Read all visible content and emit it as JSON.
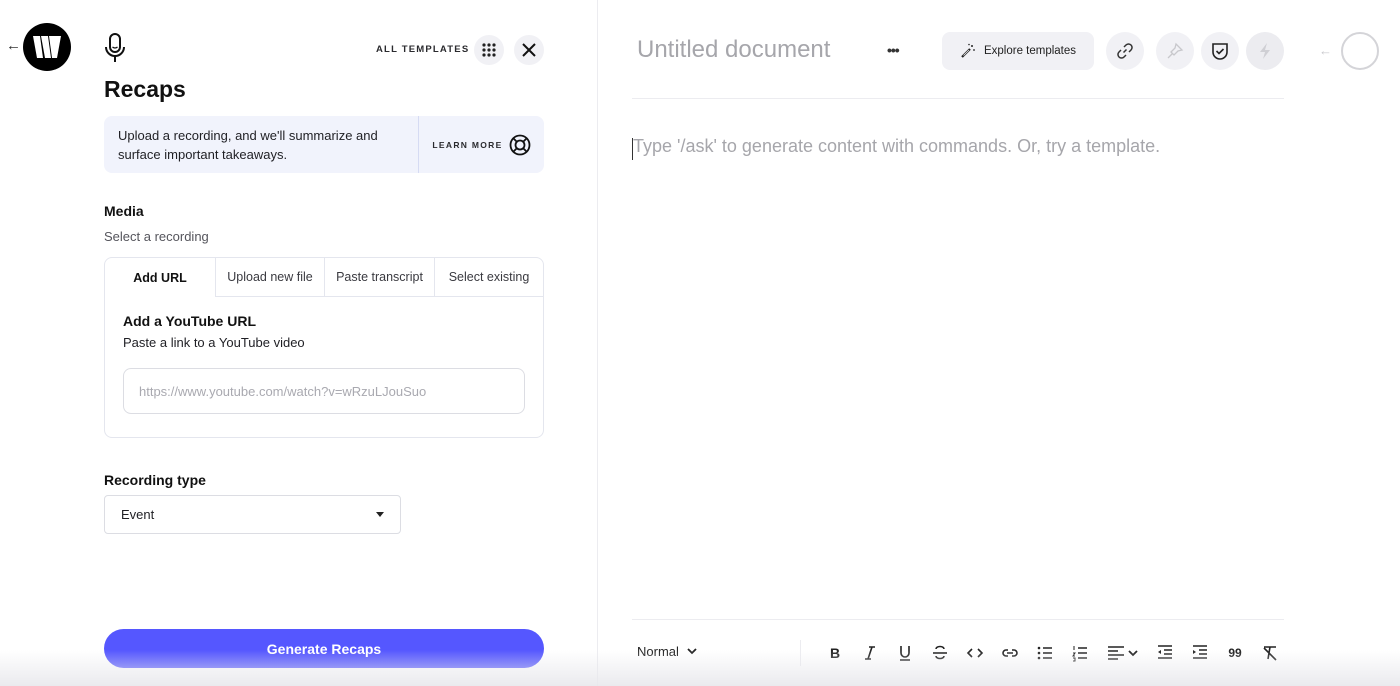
{
  "left_panel": {
    "all_templates_label": "ALL TEMPLATES",
    "title": "Recaps",
    "info": {
      "text": "Upload a recording, and we'll summarize and surface important takeaways.",
      "learn_more_label": "LEARN MORE"
    },
    "media": {
      "label": "Media",
      "sublabel": "Select a recording",
      "tabs": [
        {
          "label": "Add URL",
          "active": true
        },
        {
          "label": "Upload new file",
          "active": false
        },
        {
          "label": "Paste transcript",
          "active": false
        },
        {
          "label": "Select existing",
          "active": false
        }
      ],
      "card_title": "Add a YouTube URL",
      "card_subtitle": "Paste a link to a YouTube video",
      "url_value": "",
      "url_placeholder": "https://www.youtube.com/watch?v=wRzuLJouSuo"
    },
    "recording_type": {
      "label": "Recording type",
      "selected": "Event"
    },
    "generate_label": "Generate Recaps",
    "accent_color": "#5557ff"
  },
  "right_panel": {
    "doc_title": "Untitled document",
    "more_label": "•••",
    "explore_templates_label": "Explore templates",
    "editor_placeholder": "Type '/ask' to generate content with commands. Or, try a template.",
    "toolbar": {
      "style_selected": "Normal",
      "buttons": [
        "bold",
        "italic",
        "underline",
        "strikethrough",
        "code",
        "link",
        "bulleted-list",
        "numbered-list",
        "align",
        "outdent",
        "indent",
        "quote",
        "clear-formatting"
      ],
      "bold_label": "B",
      "italic_label": "I",
      "underline_label": "U",
      "quote_label": "99"
    }
  },
  "icons": {
    "back": "←",
    "collapse": "←"
  }
}
